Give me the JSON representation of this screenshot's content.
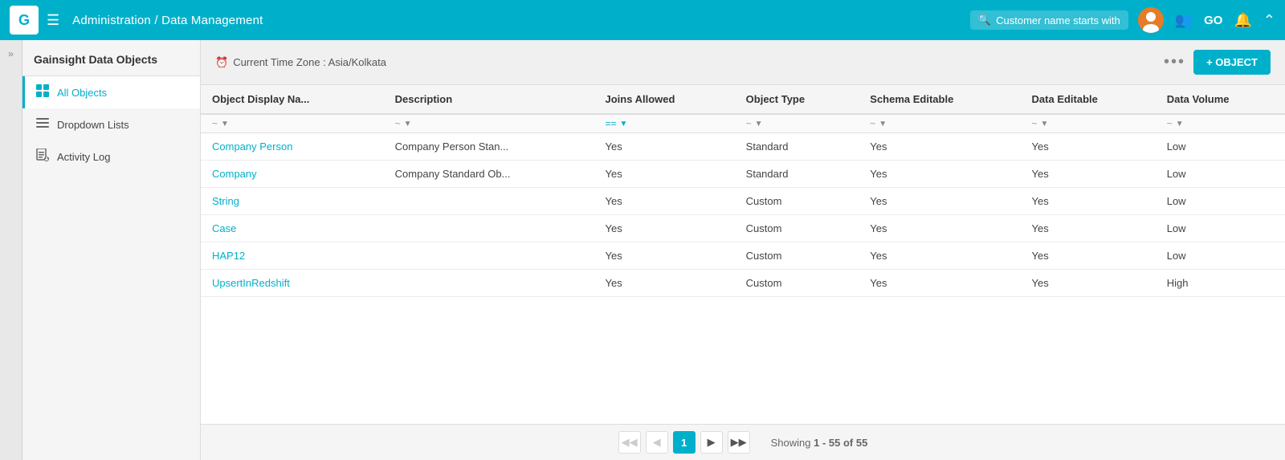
{
  "app": {
    "logo": "G",
    "breadcrumb": "Administration / Data Management"
  },
  "topnav": {
    "search_placeholder": "Customer name starts with",
    "go_label": "GO",
    "hamburger_icon": "☰",
    "search_icon": "🔍",
    "people_icon": "👥",
    "bell_icon": "🔔",
    "chevron_icon": "⌃"
  },
  "sidebar": {
    "title": "Gainsight Data Objects",
    "items": [
      {
        "label": "All Objects",
        "icon": "⊞",
        "active": true
      },
      {
        "label": "Dropdown Lists",
        "icon": "≡",
        "active": false
      },
      {
        "label": "Activity Log",
        "icon": "📋",
        "active": false
      }
    ]
  },
  "toolbar": {
    "timezone_icon": "⏰",
    "timezone_text": "Current Time Zone : Asia/Kolkata",
    "more_icon": "•••",
    "add_button_label": "+ OBJECT"
  },
  "table": {
    "columns": [
      "Object Display Na...",
      "Description",
      "Joins Allowed",
      "Object Type",
      "Schema Editable",
      "Data Editable",
      "Data Volume"
    ],
    "rows": [
      {
        "name": "Company Person",
        "description": "Company Person Stan...",
        "joins_allowed": "Yes",
        "object_type": "Standard",
        "schema_editable": "Yes",
        "data_editable": "Yes",
        "data_volume": "Low",
        "is_link": true
      },
      {
        "name": "Company",
        "description": "Company Standard Ob...",
        "joins_allowed": "Yes",
        "object_type": "Standard",
        "schema_editable": "Yes",
        "data_editable": "Yes",
        "data_volume": "Low",
        "is_link": true
      },
      {
        "name": "String",
        "description": "",
        "joins_allowed": "Yes",
        "object_type": "Custom",
        "schema_editable": "Yes",
        "data_editable": "Yes",
        "data_volume": "Low",
        "is_link": true
      },
      {
        "name": "Case",
        "description": "",
        "joins_allowed": "Yes",
        "object_type": "Custom",
        "schema_editable": "Yes",
        "data_editable": "Yes",
        "data_volume": "Low",
        "is_link": true
      },
      {
        "name": "HAP12",
        "description": "",
        "joins_allowed": "Yes",
        "object_type": "Custom",
        "schema_editable": "Yes",
        "data_editable": "Yes",
        "data_volume": "Low",
        "is_link": true
      },
      {
        "name": "UpsertInRedshift",
        "description": "",
        "joins_allowed": "Yes",
        "object_type": "Custom",
        "schema_editable": "Yes",
        "data_editable": "Yes",
        "data_volume": "High",
        "is_link": true
      }
    ]
  },
  "pagination": {
    "first_icon": "◀◀",
    "prev_icon": "◀",
    "next_icon": "▶",
    "last_icon": "▶▶",
    "current_page": "1",
    "showing_text": "Showing",
    "range_start": "1",
    "range_end": "55",
    "total": "55"
  }
}
